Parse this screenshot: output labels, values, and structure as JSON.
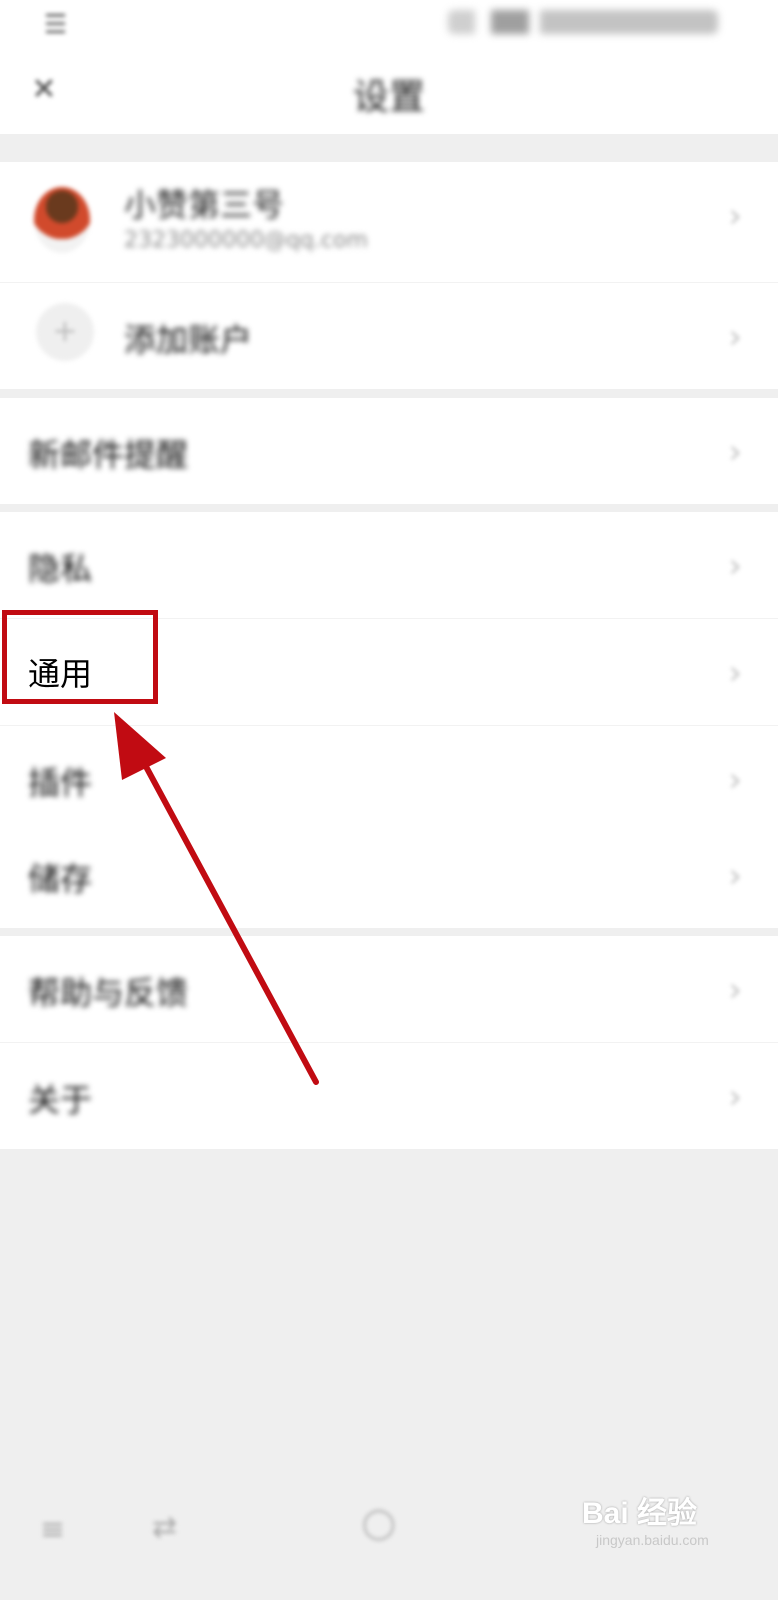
{
  "status_bar": {
    "menu_icon": "menu-icon"
  },
  "title_bar": {
    "close_icon": "close-icon",
    "title": "设置"
  },
  "account": {
    "name": "小赞第三号",
    "email": "2323000000@qq.com",
    "add_account_label": "添加账户"
  },
  "settings_items": {
    "new_mail": "新邮件提醒",
    "privacy": "隐私",
    "general": "通用",
    "plugins": "插件",
    "storage": "储存",
    "help": "帮助与反馈",
    "about": "关于"
  },
  "annotation": {
    "color": "#c10b12"
  },
  "watermark": {
    "brand": "Bai 经验",
    "sub": "jingyan.baidu.com"
  },
  "colors": {
    "background": "#efefef",
    "panel": "#ffffff",
    "accent": "#c10b12"
  }
}
